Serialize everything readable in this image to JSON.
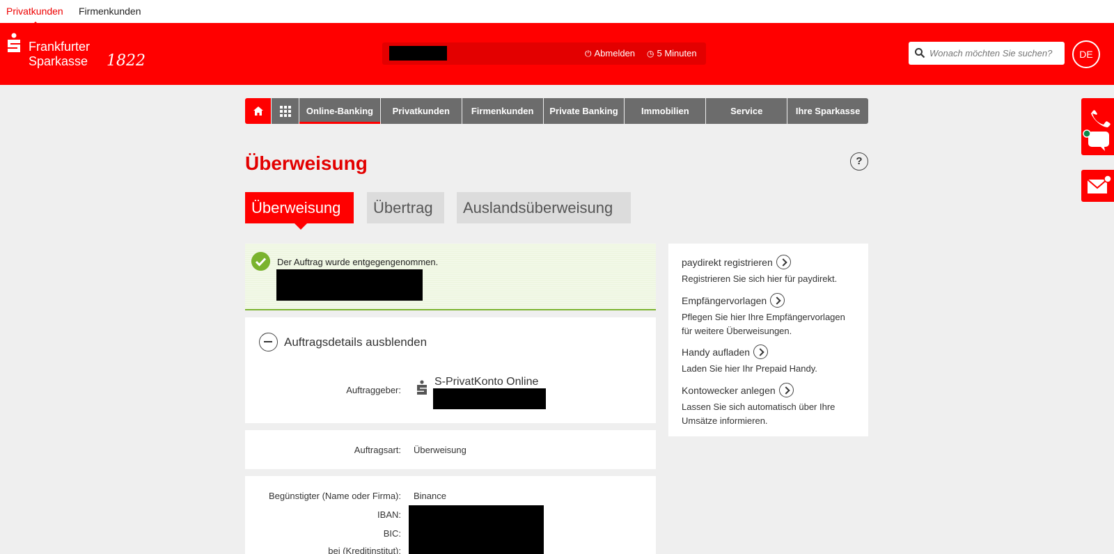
{
  "segments": {
    "private": "Privatkunden",
    "business": "Firmenkunden"
  },
  "brand": {
    "line1": "Frankfurter",
    "line2": "Sparkasse",
    "year": "1822"
  },
  "session": {
    "logout": "Abmelden",
    "timer": "5 Minuten"
  },
  "search": {
    "placeholder": "Wonach möchten Sie suchen?"
  },
  "language": "DE",
  "nav": {
    "items": [
      "Online-Banking",
      "Privatkunden",
      "Firmenkunden",
      "Private Banking",
      "Immobilien",
      "Service",
      "Ihre Sparkasse"
    ]
  },
  "page": {
    "title": "Überweisung",
    "help": "?"
  },
  "tabs": [
    "Überweisung",
    "Übertrag",
    "Auslandsüberweisung"
  ],
  "success": {
    "message": "Der Auftrag wurde entgegengenommen."
  },
  "details": {
    "toggle_label": "Auftragsdetails ausblenden",
    "ordering_party_label": "Auftraggeber:",
    "account_name": "S-PrivatKonto Online",
    "order_type_label": "Auftragsart:",
    "order_type_value": "Überweisung",
    "beneficiary_label": "Begünstigter (Name oder Firma):",
    "beneficiary_value": "Binance",
    "iban_label": "IBAN:",
    "bic_label": "BIC:",
    "bank_label": "bei (Kreditinstitut):"
  },
  "aside": [
    {
      "title": "paydirekt registrieren",
      "desc": "Registrieren Sie sich hier für paydirekt."
    },
    {
      "title": "Empfängervorlagen",
      "desc": "Pflegen Sie hier Ihre Empfängervorlagen für weitere Überweisungen."
    },
    {
      "title": "Handy aufladen",
      "desc": "Laden Sie hier Ihr Prepaid Handy."
    },
    {
      "title": "Kontowecker anlegen",
      "desc": "Lassen Sie sich automatisch über Ihre Umsätze informieren."
    }
  ],
  "colors": {
    "brand_red": "#ff0000",
    "nav_gray": "#6c6c6c",
    "success_green": "#7ab32e"
  }
}
